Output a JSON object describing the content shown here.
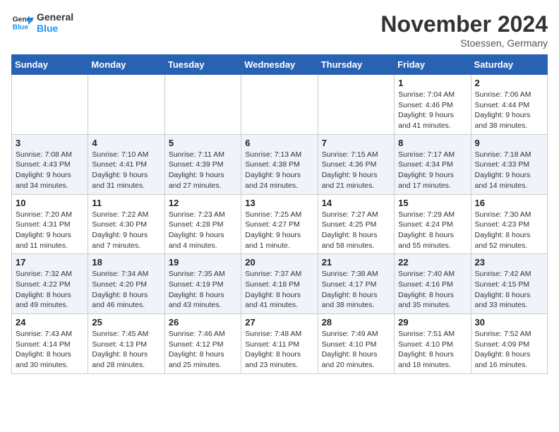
{
  "logo": {
    "line1": "General",
    "line2": "Blue"
  },
  "title": "November 2024",
  "location": "Stoessen, Germany",
  "days_of_week": [
    "Sunday",
    "Monday",
    "Tuesday",
    "Wednesday",
    "Thursday",
    "Friday",
    "Saturday"
  ],
  "weeks": [
    [
      {
        "day": "",
        "info": ""
      },
      {
        "day": "",
        "info": ""
      },
      {
        "day": "",
        "info": ""
      },
      {
        "day": "",
        "info": ""
      },
      {
        "day": "",
        "info": ""
      },
      {
        "day": "1",
        "info": "Sunrise: 7:04 AM\nSunset: 4:46 PM\nDaylight: 9 hours and 41 minutes."
      },
      {
        "day": "2",
        "info": "Sunrise: 7:06 AM\nSunset: 4:44 PM\nDaylight: 9 hours and 38 minutes."
      }
    ],
    [
      {
        "day": "3",
        "info": "Sunrise: 7:08 AM\nSunset: 4:43 PM\nDaylight: 9 hours and 34 minutes."
      },
      {
        "day": "4",
        "info": "Sunrise: 7:10 AM\nSunset: 4:41 PM\nDaylight: 9 hours and 31 minutes."
      },
      {
        "day": "5",
        "info": "Sunrise: 7:11 AM\nSunset: 4:39 PM\nDaylight: 9 hours and 27 minutes."
      },
      {
        "day": "6",
        "info": "Sunrise: 7:13 AM\nSunset: 4:38 PM\nDaylight: 9 hours and 24 minutes."
      },
      {
        "day": "7",
        "info": "Sunrise: 7:15 AM\nSunset: 4:36 PM\nDaylight: 9 hours and 21 minutes."
      },
      {
        "day": "8",
        "info": "Sunrise: 7:17 AM\nSunset: 4:34 PM\nDaylight: 9 hours and 17 minutes."
      },
      {
        "day": "9",
        "info": "Sunrise: 7:18 AM\nSunset: 4:33 PM\nDaylight: 9 hours and 14 minutes."
      }
    ],
    [
      {
        "day": "10",
        "info": "Sunrise: 7:20 AM\nSunset: 4:31 PM\nDaylight: 9 hours and 11 minutes."
      },
      {
        "day": "11",
        "info": "Sunrise: 7:22 AM\nSunset: 4:30 PM\nDaylight: 9 hours and 7 minutes."
      },
      {
        "day": "12",
        "info": "Sunrise: 7:23 AM\nSunset: 4:28 PM\nDaylight: 9 hours and 4 minutes."
      },
      {
        "day": "13",
        "info": "Sunrise: 7:25 AM\nSunset: 4:27 PM\nDaylight: 9 hours and 1 minute."
      },
      {
        "day": "14",
        "info": "Sunrise: 7:27 AM\nSunset: 4:25 PM\nDaylight: 8 hours and 58 minutes."
      },
      {
        "day": "15",
        "info": "Sunrise: 7:29 AM\nSunset: 4:24 PM\nDaylight: 8 hours and 55 minutes."
      },
      {
        "day": "16",
        "info": "Sunrise: 7:30 AM\nSunset: 4:23 PM\nDaylight: 8 hours and 52 minutes."
      }
    ],
    [
      {
        "day": "17",
        "info": "Sunrise: 7:32 AM\nSunset: 4:22 PM\nDaylight: 8 hours and 49 minutes."
      },
      {
        "day": "18",
        "info": "Sunrise: 7:34 AM\nSunset: 4:20 PM\nDaylight: 8 hours and 46 minutes."
      },
      {
        "day": "19",
        "info": "Sunrise: 7:35 AM\nSunset: 4:19 PM\nDaylight: 8 hours and 43 minutes."
      },
      {
        "day": "20",
        "info": "Sunrise: 7:37 AM\nSunset: 4:18 PM\nDaylight: 8 hours and 41 minutes."
      },
      {
        "day": "21",
        "info": "Sunrise: 7:38 AM\nSunset: 4:17 PM\nDaylight: 8 hours and 38 minutes."
      },
      {
        "day": "22",
        "info": "Sunrise: 7:40 AM\nSunset: 4:16 PM\nDaylight: 8 hours and 35 minutes."
      },
      {
        "day": "23",
        "info": "Sunrise: 7:42 AM\nSunset: 4:15 PM\nDaylight: 8 hours and 33 minutes."
      }
    ],
    [
      {
        "day": "24",
        "info": "Sunrise: 7:43 AM\nSunset: 4:14 PM\nDaylight: 8 hours and 30 minutes."
      },
      {
        "day": "25",
        "info": "Sunrise: 7:45 AM\nSunset: 4:13 PM\nDaylight: 8 hours and 28 minutes."
      },
      {
        "day": "26",
        "info": "Sunrise: 7:46 AM\nSunset: 4:12 PM\nDaylight: 8 hours and 25 minutes."
      },
      {
        "day": "27",
        "info": "Sunrise: 7:48 AM\nSunset: 4:11 PM\nDaylight: 8 hours and 23 minutes."
      },
      {
        "day": "28",
        "info": "Sunrise: 7:49 AM\nSunset: 4:10 PM\nDaylight: 8 hours and 20 minutes."
      },
      {
        "day": "29",
        "info": "Sunrise: 7:51 AM\nSunset: 4:10 PM\nDaylight: 8 hours and 18 minutes."
      },
      {
        "day": "30",
        "info": "Sunrise: 7:52 AM\nSunset: 4:09 PM\nDaylight: 8 hours and 16 minutes."
      }
    ]
  ]
}
